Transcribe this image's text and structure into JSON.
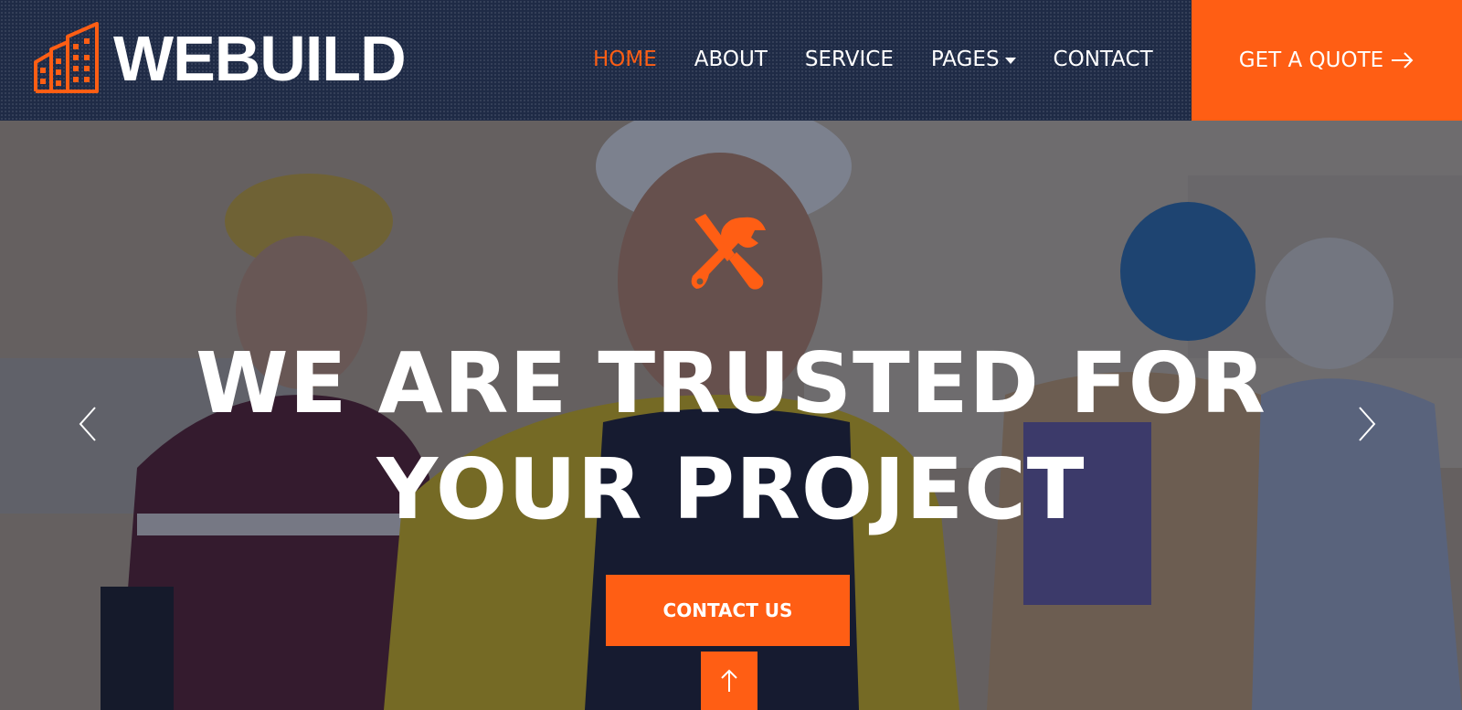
{
  "brand": {
    "name": "WEBUILD",
    "logo_icon": "building-icon"
  },
  "nav": {
    "items": [
      {
        "label": "HOME",
        "active": true
      },
      {
        "label": "ABOUT",
        "active": false
      },
      {
        "label": "SERVICE",
        "active": false
      },
      {
        "label": "PAGES",
        "active": false,
        "dropdown": true
      },
      {
        "label": "CONTACT",
        "active": false
      }
    ],
    "cta_label": "GET A QUOTE",
    "cta_icon": "arrow-right-icon"
  },
  "hero": {
    "icon": "tools-icon",
    "title_line1": "WE ARE TRUSTED FOR",
    "title_line2": "YOUR PROJECT",
    "button_label": "CONTACT US",
    "prev_icon": "chevron-left-icon",
    "next_icon": "chevron-right-icon",
    "scroll_top_icon": "arrow-up-icon"
  },
  "colors": {
    "accent": "#ff5e14",
    "navbar": "#1f2b46",
    "text": "#ffffff"
  }
}
